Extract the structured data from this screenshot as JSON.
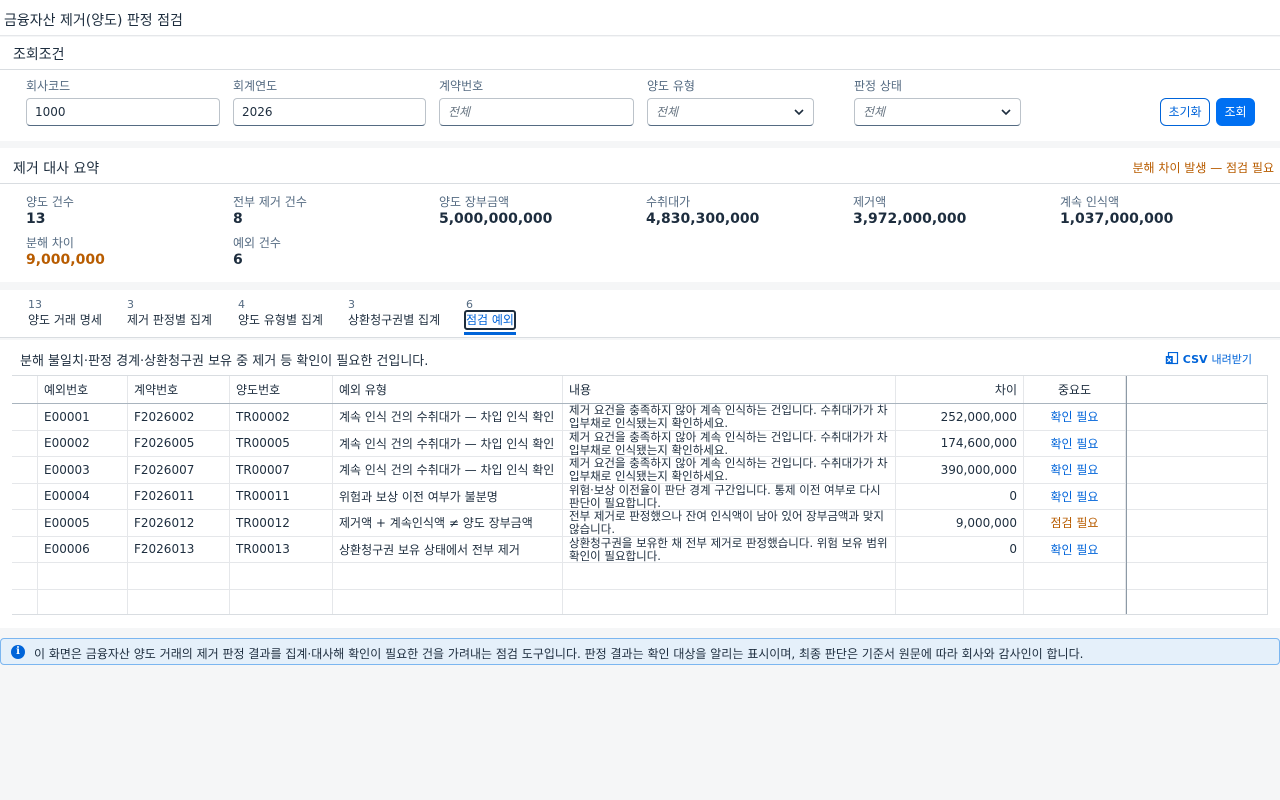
{
  "page": {
    "title": "금융자산 제거(양도) 판정 점검"
  },
  "filters": {
    "title": "조회조건",
    "company_code": {
      "label": "회사코드",
      "value": "1000"
    },
    "fiscal_year": {
      "label": "회계연도",
      "value": "2026"
    },
    "contract_no": {
      "label": "계약번호",
      "placeholder": "전체"
    },
    "transfer_type": {
      "label": "양도 유형",
      "value": "전체"
    },
    "judgment_status": {
      "label": "판정 상태",
      "value": "전체"
    },
    "reset_label": "초기화",
    "search_label": "조회"
  },
  "summary": {
    "title": "제거 대사 요약",
    "alert": "분해 차이 발생 — 점검 필요",
    "kpis": [
      {
        "label": "양도 건수",
        "value": "13"
      },
      {
        "label": "전부 제거 건수",
        "value": "8"
      },
      {
        "label": "양도 장부금액",
        "value": "5,000,000,000"
      },
      {
        "label": "수취대가",
        "value": "4,830,300,000"
      },
      {
        "label": "제거액",
        "value": "3,972,000,000"
      },
      {
        "label": "계속 인식액",
        "value": "1,037,000,000"
      },
      {
        "label": "분해 차이",
        "value": "9,000,000"
      },
      {
        "label": "예외 건수",
        "value": "6"
      }
    ]
  },
  "tabs": [
    {
      "count": "13",
      "label": "양도 거래 명세"
    },
    {
      "count": "3",
      "label": "제거 판정별 집계"
    },
    {
      "count": "4",
      "label": "양도 유형별 집계"
    },
    {
      "count": "3",
      "label": "상환청구권별 집계"
    },
    {
      "count": "6",
      "label": "점검 예외"
    }
  ],
  "exceptions": {
    "description": "분해 불일치·판정 경계·상환청구권 보유 중 제거 등 확인이 필요한 건입니다.",
    "csv_label": "CSV",
    "csv_suffix": "내려받기",
    "columns": [
      "예외번호",
      "계약번호",
      "양도번호",
      "예외 유형",
      "내용",
      "차이",
      "중요도"
    ],
    "rows": [
      {
        "id": "E00001",
        "contract": "F2026002",
        "transfer": "TR00002",
        "type": "계속 인식 건의 수취대가 — 차입 인식 확인",
        "content": "제거 요건을 충족하지 않아 계속 인식하는 건입니다. 수취대가가 차입부채로 인식됐는지 확인하세요.",
        "diff": "252,000,000",
        "severity": "확인 필요"
      },
      {
        "id": "E00002",
        "contract": "F2026005",
        "transfer": "TR00005",
        "type": "계속 인식 건의 수취대가 — 차입 인식 확인",
        "content": "제거 요건을 충족하지 않아 계속 인식하는 건입니다. 수취대가가 차입부채로 인식됐는지 확인하세요.",
        "diff": "174,600,000",
        "severity": "확인 필요"
      },
      {
        "id": "E00003",
        "contract": "F2026007",
        "transfer": "TR00007",
        "type": "계속 인식 건의 수취대가 — 차입 인식 확인",
        "content": "제거 요건을 충족하지 않아 계속 인식하는 건입니다. 수취대가가 차입부채로 인식됐는지 확인하세요.",
        "diff": "390,000,000",
        "severity": "확인 필요"
      },
      {
        "id": "E00004",
        "contract": "F2026011",
        "transfer": "TR00011",
        "type": "위험과 보상 이전 여부가 불분명",
        "content": "위험·보상 이전율이 판단 경계 구간입니다. 통제 이전 여부로 다시 판단이 필요합니다.",
        "diff": "0",
        "severity": "확인 필요"
      },
      {
        "id": "E00005",
        "contract": "F2026012",
        "transfer": "TR00012",
        "type": "제거액 + 계속인식액 ≠ 양도 장부금액",
        "content": "전부 제거로 판정했으나 잔여 인식액이 남아 있어 장부금액과 맞지 않습니다.",
        "diff": "9,000,000",
        "severity": "점검 필요"
      },
      {
        "id": "E00006",
        "contract": "F2026013",
        "transfer": "TR00013",
        "type": "상환청구권 보유 상태에서 전부 제거",
        "content": "상환청구권을 보유한 채 전부 제거로 판정했습니다. 위험 보유 범위 확인이 필요합니다.",
        "diff": "0",
        "severity": "확인 필요"
      }
    ]
  },
  "info": {
    "text": "이 화면은 금융자산 양도 거래의 제거 판정 결과를 집계·대사해 확인이 필요한 건을 가려내는 점검 도구입니다. 판정 결과는 확인 대상을 알리는 표시이며, 최종 판단은 기준서 원문에 따라 회사와 감사인이 합니다."
  }
}
